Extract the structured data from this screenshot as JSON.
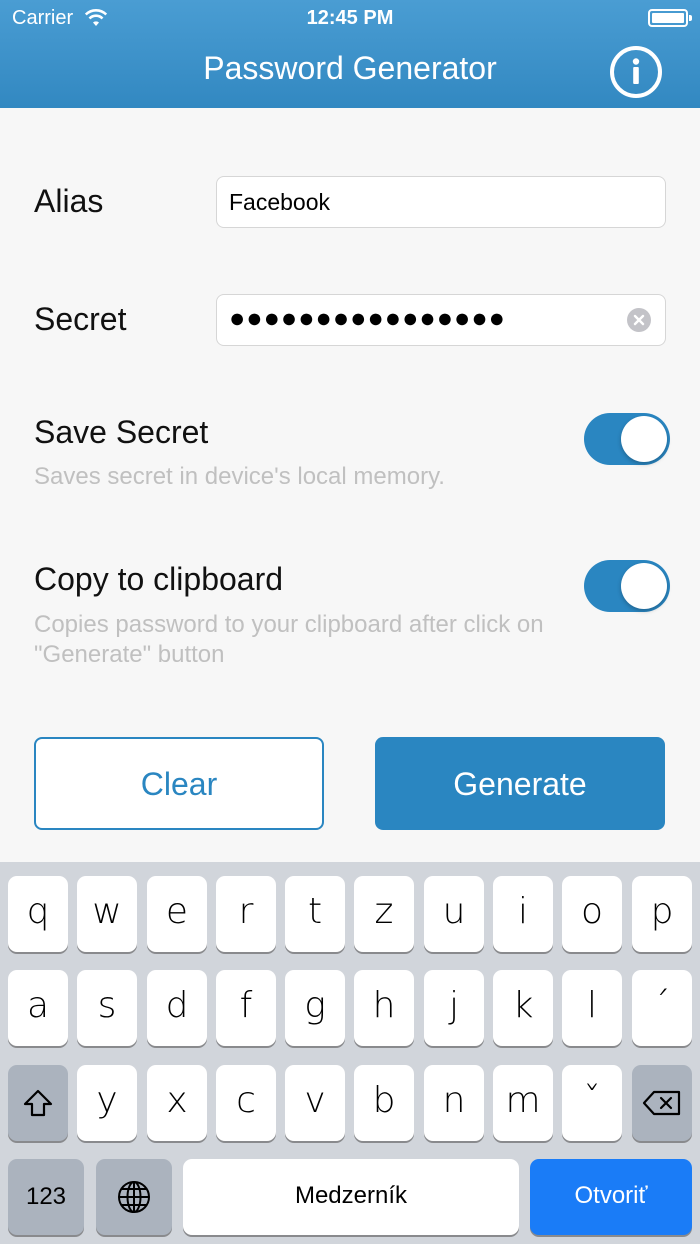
{
  "status_bar": {
    "carrier": "Carrier",
    "time": "12:45 PM"
  },
  "header": {
    "title": "Password Generator",
    "info_icon": "info-icon"
  },
  "form": {
    "alias_label": "Alias",
    "alias_value": "Facebook",
    "secret_label": "Secret",
    "secret_value": "●●●●●●●●●●●●●●●●",
    "save_secret": {
      "title": "Save Secret",
      "description": "Saves secret in device's local memory.",
      "on": true
    },
    "copy_clipboard": {
      "title": "Copy to clipboard",
      "description": "Copies password to your clipboard after click on \"Generate\" button",
      "on": true
    }
  },
  "buttons": {
    "clear": "Clear",
    "generate": "Generate"
  },
  "keyboard": {
    "row1": [
      "q",
      "w",
      "e",
      "r",
      "t",
      "z",
      "u",
      "i",
      "o",
      "p"
    ],
    "row2": [
      "a",
      "s",
      "d",
      "f",
      "g",
      "h",
      "j",
      "k",
      "l",
      "´"
    ],
    "row3": [
      "y",
      "x",
      "c",
      "v",
      "b",
      "n",
      "m",
      "ˇ"
    ],
    "numbers": "123",
    "space": "Medzerník",
    "go": "Otvoriť"
  },
  "colors": {
    "accent": "#2a86c1",
    "header": "#3a8fc8",
    "keyboard_bg": "#d1d5db",
    "go_key": "#1a7cf7"
  }
}
